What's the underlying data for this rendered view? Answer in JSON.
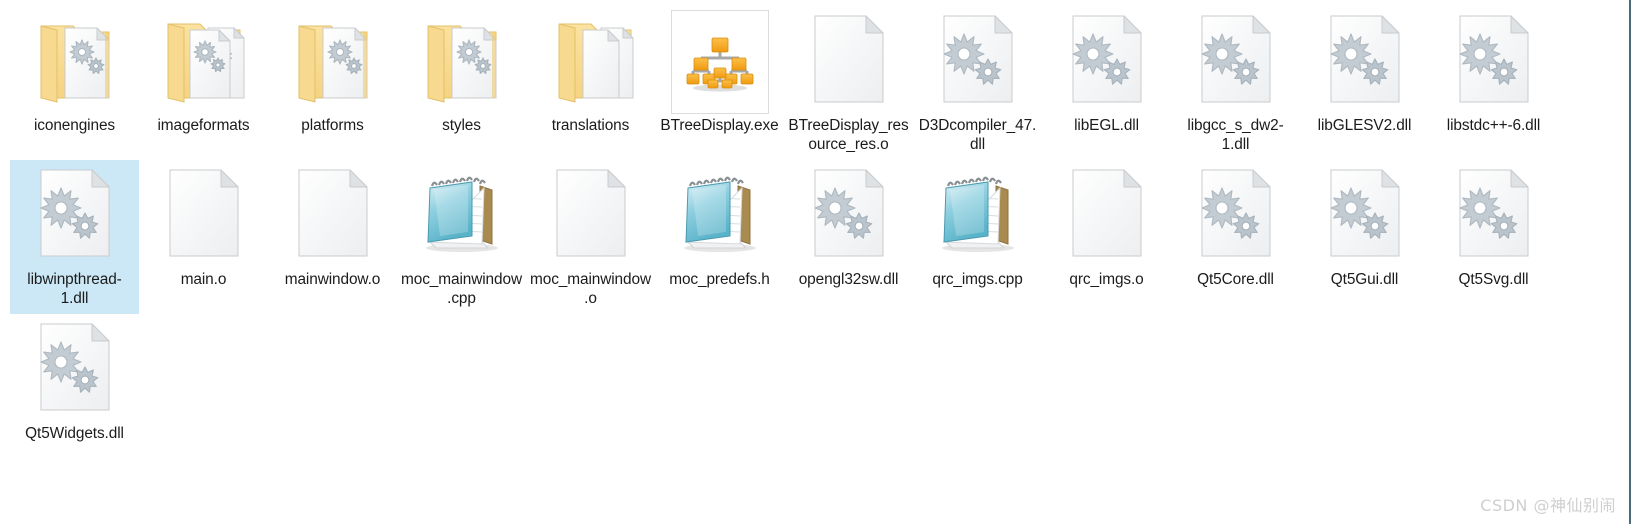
{
  "view": {
    "name": "windows-explorer-icon-view",
    "background_color": "#ffffff",
    "selection_color": "#cce8f6",
    "label_color": "#1b1b1b",
    "right_edge_color": "#4a6b78"
  },
  "watermark": {
    "text": "CSDN @神仙别闹",
    "color": "#cfcfcf"
  },
  "items": [
    {
      "label": "iconengines",
      "icon": "folder-with-gear-doc-icon",
      "type": "folder",
      "selected": false
    },
    {
      "label": "imageformats",
      "icon": "folder-with-gear-docs-icon",
      "type": "folder",
      "selected": false
    },
    {
      "label": "platforms",
      "icon": "folder-with-gear-doc-icon",
      "type": "folder",
      "selected": false
    },
    {
      "label": "styles",
      "icon": "folder-with-gear-doc-icon",
      "type": "folder",
      "selected": false
    },
    {
      "label": "translations",
      "icon": "folder-with-blank-docs-icon",
      "type": "folder",
      "selected": false
    },
    {
      "label": "BTreeDisplay.exe",
      "icon": "tree-diagram-app-icon",
      "type": "exe",
      "selected": false
    },
    {
      "label": "BTreeDisplay_resource_res.o",
      "icon": "blank-document-icon",
      "type": "object",
      "selected": false
    },
    {
      "label": "D3Dcompiler_47.dll",
      "icon": "gears-document-icon",
      "type": "dll",
      "selected": false
    },
    {
      "label": "libEGL.dll",
      "icon": "gears-document-icon",
      "type": "dll",
      "selected": false
    },
    {
      "label": "libgcc_s_dw2-1.dll",
      "icon": "gears-document-icon",
      "type": "dll",
      "selected": false
    },
    {
      "label": "libGLESV2.dll",
      "icon": "gears-document-icon",
      "type": "dll",
      "selected": false
    },
    {
      "label": "libstdc++-6.dll",
      "icon": "gears-document-icon",
      "type": "dll",
      "selected": false
    },
    {
      "label": "libwinpthread-1.dll",
      "icon": "gears-document-icon",
      "type": "dll",
      "selected": true
    },
    {
      "label": "main.o",
      "icon": "blank-document-icon",
      "type": "object",
      "selected": false
    },
    {
      "label": "mainwindow.o",
      "icon": "blank-document-icon",
      "type": "object",
      "selected": false
    },
    {
      "label": "moc_mainwindow.cpp",
      "icon": "notepad-icon",
      "type": "text",
      "selected": false
    },
    {
      "label": "moc_mainwindow.o",
      "icon": "blank-document-icon",
      "type": "object",
      "selected": false
    },
    {
      "label": "moc_predefs.h",
      "icon": "notepad-icon",
      "type": "text",
      "selected": false
    },
    {
      "label": "opengl32sw.dll",
      "icon": "gears-document-icon",
      "type": "dll",
      "selected": false
    },
    {
      "label": "qrc_imgs.cpp",
      "icon": "notepad-icon",
      "type": "text",
      "selected": false
    },
    {
      "label": "qrc_imgs.o",
      "icon": "blank-document-icon",
      "type": "object",
      "selected": false
    },
    {
      "label": "Qt5Core.dll",
      "icon": "gears-document-icon",
      "type": "dll",
      "selected": false
    },
    {
      "label": "Qt5Gui.dll",
      "icon": "gears-document-icon",
      "type": "dll",
      "selected": false
    },
    {
      "label": "Qt5Svg.dll",
      "icon": "gears-document-icon",
      "type": "dll",
      "selected": false
    },
    {
      "label": "Qt5Widgets.dll",
      "icon": "gears-document-icon",
      "type": "dll",
      "selected": false
    }
  ]
}
